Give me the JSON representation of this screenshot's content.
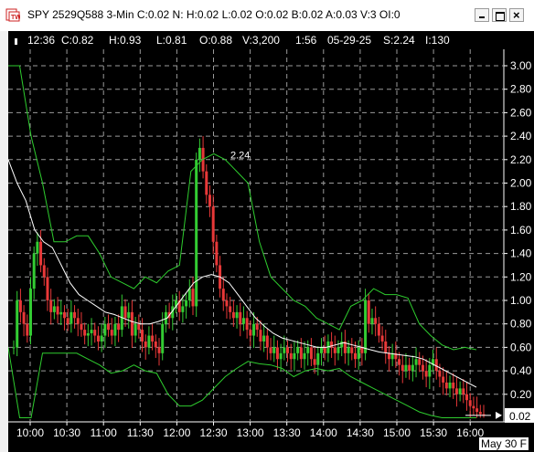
{
  "title": "SPY 2529Q588 3-Min C:0.02 N: H:0.02 L:0.02 O:0.02 B:0.02 A:0.03 V:3 OI:0",
  "status": {
    "time": "12:36",
    "close": "C:0.82",
    "high": "H:0.93",
    "low": "L:0.81",
    "open": "O:0.88",
    "volume": "V:3,200",
    "duration": "1:56",
    "date": "05-29-25",
    "s": "S:2.24",
    "i": "I:130"
  },
  "max_marker_label": "2.24",
  "last_price_label": "0.02",
  "date_footer": "May 30 F",
  "colors": {
    "background": "#000000",
    "bullish": "#33cc33",
    "bearish": "#e83838",
    "bands": "#2ecc2e",
    "average": "#ffffff",
    "grid": "#9a9a9a"
  },
  "chart_data": {
    "type": "candlestick",
    "xlabel": "",
    "ylabel": "",
    "ylim": [
      0,
      3.1
    ],
    "y_ticks": [
      "3.00",
      "2.80",
      "2.60",
      "2.40",
      "2.20",
      "2.00",
      "1.80",
      "1.60",
      "1.40",
      "1.20",
      "1.00",
      "0.80",
      "0.60",
      "0.40",
      "0.20"
    ],
    "x_ticks": [
      "10:00",
      "10:30",
      "11:00",
      "11:30",
      "12:00",
      "12:30",
      "13:00",
      "13:30",
      "14:00",
      "14:30",
      "15:00",
      "15:30",
      "16:00"
    ],
    "grid": true,
    "close_series": [
      0.6,
      1.0,
      0.9,
      0.8,
      0.7,
      1.1,
      1.4,
      1.5,
      1.3,
      1.2,
      1.0,
      0.9,
      0.95,
      0.88,
      0.9,
      0.85,
      0.8,
      0.9,
      0.85,
      0.8,
      0.75,
      0.7,
      0.72,
      0.75,
      0.7,
      0.65,
      0.7,
      0.8,
      0.75,
      0.7,
      0.8,
      0.75,
      0.95,
      0.85,
      0.9,
      0.7,
      0.8,
      0.75,
      0.65,
      0.6,
      0.7,
      0.65,
      0.6,
      0.55,
      0.8,
      0.9,
      0.85,
      0.95,
      1.0,
      0.9,
      0.95,
      1.0,
      1.1,
      0.95,
      2.2,
      2.3,
      2.1,
      1.9,
      1.8,
      1.5,
      1.3,
      1.1,
      1.0,
      0.95,
      0.9,
      0.85,
      0.9,
      0.8,
      0.85,
      0.75,
      0.7,
      0.8,
      0.75,
      0.65,
      0.7,
      0.6,
      0.55,
      0.6,
      0.5,
      0.55,
      0.6,
      0.55,
      0.5,
      0.55,
      0.6,
      0.5,
      0.55,
      0.6,
      0.5,
      0.45,
      0.55,
      0.6,
      0.55,
      0.65,
      0.6,
      0.55,
      0.6,
      0.65,
      0.55,
      0.6,
      0.55,
      0.5,
      0.6,
      0.55,
      1.0,
      0.8,
      0.85,
      0.8,
      0.7,
      0.65,
      0.55,
      0.5,
      0.55,
      0.5,
      0.45,
      0.4,
      0.45,
      0.4,
      0.45,
      0.5,
      0.45,
      0.4,
      0.35,
      0.45,
      0.5,
      0.4,
      0.35,
      0.3,
      0.25,
      0.3,
      0.25,
      0.2,
      0.25,
      0.2,
      0.15,
      0.1,
      0.08,
      0.05,
      0.03,
      0.02
    ],
    "series": [
      {
        "values": [
          2.2,
          2.0,
          1.85,
          1.6,
          1.5,
          1.45,
          1.3,
          1.15,
          1.05,
          1.0,
          0.95,
          0.9,
          0.88,
          0.85,
          0.82,
          0.8,
          0.8,
          0.82,
          0.85,
          0.95,
          1.05,
          1.15,
          1.2,
          1.22,
          1.2,
          1.15,
          1.05,
          0.95,
          0.85,
          0.78,
          0.72,
          0.68,
          0.66,
          0.64,
          0.62,
          0.6,
          0.6,
          0.62,
          0.64,
          0.62,
          0.6,
          0.58,
          0.56,
          0.55,
          0.54,
          0.53,
          0.52,
          0.5,
          0.46,
          0.42,
          0.38,
          0.34,
          0.3,
          0.26
        ]
      },
      {
        "values": [
          3.0,
          3.0,
          2.4,
          2.0,
          1.5,
          1.5,
          1.55,
          1.55,
          1.4,
          1.2,
          1.15,
          1.1,
          1.2,
          1.15,
          1.25,
          1.3,
          2.1,
          2.2,
          2.25,
          2.2,
          2.1,
          2.0,
          1.5,
          1.2,
          1.1,
          1.0,
          0.95,
          0.85,
          0.8,
          0.75,
          0.95,
          1.0,
          1.1,
          1.05,
          1.05,
          1.02,
          0.8,
          0.7,
          0.62,
          0.58,
          0.6,
          0.58
        ]
      },
      {
        "values": [
          0.6,
          0.0,
          0.0,
          0.55,
          0.55,
          0.55,
          0.55,
          0.5,
          0.45,
          0.38,
          0.4,
          0.45,
          0.4,
          0.38,
          0.2,
          0.1,
          0.1,
          0.15,
          0.25,
          0.35,
          0.42,
          0.48,
          0.46,
          0.45,
          0.42,
          0.35,
          0.4,
          0.42,
          0.4,
          0.42,
          0.35,
          0.3,
          0.25,
          0.2,
          0.15,
          0.1,
          0.05,
          0.02,
          0.0,
          0.0,
          0.0,
          0.0
        ]
      }
    ]
  }
}
